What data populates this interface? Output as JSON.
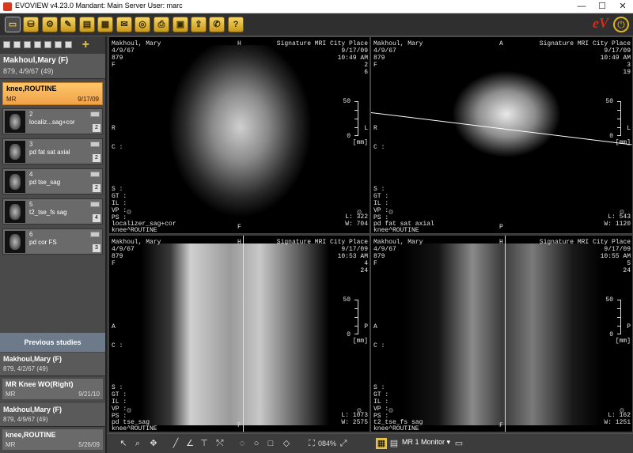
{
  "window": {
    "title": "EVOVIEW v4.23.0   Mandant: Main Server   User: marc",
    "min": "—",
    "max": "☐",
    "close": "✕"
  },
  "toolbar": {
    "buttons": [
      "viewer-icon",
      "database-icon",
      "settings-icon",
      "tools-icon",
      "clipboard-icon",
      "report-icon",
      "send-icon",
      "cd-icon",
      "print-icon",
      "film-icon",
      "export-icon",
      "chat-icon",
      "help-icon"
    ],
    "glyphs": [
      "▭",
      "⛁",
      "⚙",
      "✎",
      "▤",
      "▦",
      "✉",
      "◎",
      "⎙",
      "▣",
      "⇪",
      "✆",
      "?"
    ],
    "logo": "eV",
    "power": "⏻"
  },
  "left": {
    "plus": "+",
    "patient": {
      "name": "Makhoul,Mary (F)",
      "sub": "879, 4/9/67 (49)"
    },
    "study": {
      "title": "knee,ROUTINE",
      "modality": "MR",
      "date": "9/17/09"
    },
    "series": [
      {
        "num": "2",
        "name": "localiz...sag+cor",
        "count": "2"
      },
      {
        "num": "3",
        "name": "pd fat sat axial",
        "count": "2"
      },
      {
        "num": "4",
        "name": "pd tse_sag",
        "count": "2"
      },
      {
        "num": "5",
        "name": "t2_tse_fs sag",
        "count": "4"
      },
      {
        "num": "6",
        "name": "pd cor FS",
        "count": "3"
      }
    ],
    "previous_header": "Previous studies",
    "previous": [
      {
        "patient": "Makhoul,Mary (F)",
        "sub": "879, 4/2/67 (49)",
        "study": "MR Knee WO(Right)",
        "modality": "MR",
        "date": "9/21/10"
      },
      {
        "patient": "Makhoul,Mary (F)",
        "sub": "879, 4/9/67 (49)",
        "study": "knee,ROUTINE",
        "modality": "MR",
        "date": "5/26/09"
      }
    ]
  },
  "viewports": [
    {
      "name": "Makhoul, Mary",
      "dob": "4/9/67",
      "id": "879",
      "letter_f": "F",
      "orient_top": "H",
      "orient_bottom": "F",
      "orient_left": "R",
      "orient_right": "L",
      "c": "C :",
      "site": "Signature MRI City Place",
      "date": "9/17/09",
      "time": "10:49 AM",
      "n1": "2",
      "n2": "6",
      "s": "S :",
      "gt": "GT :",
      "il": "IL :",
      "vp": "VP :",
      "ps": "PS :",
      "series": "localizer_sag+cor",
      "study": "knee^ROUTINE",
      "l": "L: 322",
      "w": "W: 704",
      "scale_top": "50",
      "scale_bot": "0",
      "mm": "[mm]"
    },
    {
      "name": "Makhoul, Mary",
      "dob": "4/9/67",
      "id": "879",
      "letter_f": "F",
      "orient_top": "A",
      "orient_bottom": "P",
      "orient_left": "R",
      "orient_right": "L",
      "c": "C :",
      "site": "Signature MRI City Place",
      "date": "9/17/09",
      "time": "10:49 AM",
      "n1": "3",
      "n2": "19",
      "s": "S :",
      "gt": "GT :",
      "il": "IL :",
      "vp": "VP :",
      "ps": "PS :",
      "series": "pd fat sat axial",
      "study": "knee^ROUTINE",
      "l": "L: 543",
      "w": "W: 1120",
      "scale_top": "50",
      "scale_bot": "0",
      "mm": "[mm]"
    },
    {
      "name": "Makhoul, Mary",
      "dob": "4/9/67",
      "id": "879",
      "letter_f": "F",
      "orient_top": "H",
      "orient_bottom": "F",
      "orient_left": "A",
      "orient_right": "P",
      "c": "C :",
      "site": "Signature MRI City Place",
      "date": "9/17/09",
      "time": "10:53 AM",
      "n1": "4",
      "n2": "24",
      "s": "S :",
      "gt": "GT :",
      "il": "IL :",
      "vp": "VP :",
      "ps": "PS :",
      "series": "pd tse_sag",
      "study": "knee^ROUTINE",
      "l": "L: 1073",
      "w": "W: 2575",
      "scale_top": "50",
      "scale_bot": "0",
      "mm": "[mm]"
    },
    {
      "name": "Makhoul, Mary",
      "dob": "4/9/67",
      "id": "879",
      "letter_f": "F",
      "orient_top": "H",
      "orient_bottom": "F",
      "orient_left": "A",
      "orient_right": "P",
      "c": "C :",
      "site": "Signature MRI City Place",
      "date": "9/17/09",
      "time": "10:55 AM",
      "n1": "5",
      "n2": "24",
      "s": "S :",
      "gt": "GT :",
      "il": "IL :",
      "vp": "VP :",
      "ps": "PS :",
      "series": "t2_tse_fs sag",
      "study": "knee^ROUTINE",
      "l": "L: 162",
      "w": "W: 1251",
      "scale_top": "50",
      "scale_bot": "0",
      "mm": "[mm]"
    }
  ],
  "bottom": {
    "tools": [
      "↖",
      "⌕",
      "✥",
      "╱",
      "∠",
      "⊤",
      "⤲",
      "◌",
      "○",
      "□",
      "◇"
    ],
    "tool_names": [
      "pointer-icon",
      "zoom-icon",
      "pan-icon",
      "line-icon",
      "angle-icon",
      "text-icon",
      "arrow-icon",
      "freehand-icon",
      "ellipse-icon",
      "rectangle-icon",
      "polygon-icon"
    ],
    "zoom": "084%",
    "monitor": "MR 1 Monitor ▾"
  }
}
